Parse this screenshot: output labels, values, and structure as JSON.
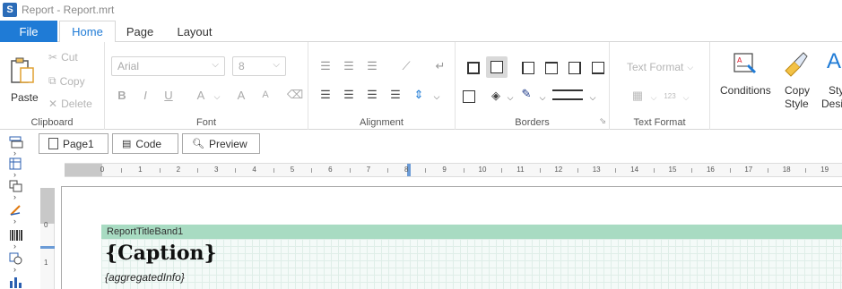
{
  "window": {
    "title": "Report - Report.mrt"
  },
  "ribbon_tabs": {
    "file": "File",
    "home": "Home",
    "page": "Page",
    "layout": "Layout"
  },
  "clipboard": {
    "paste": "Paste",
    "cut": "Cut",
    "copy": "Copy",
    "delete": "Delete",
    "label": "Clipboard"
  },
  "font": {
    "family": "Arial",
    "size": "8",
    "label": "Font",
    "bold": "B",
    "italic": "I",
    "underline": "U",
    "grow": "A",
    "shrink": "A"
  },
  "alignment": {
    "label": "Alignment"
  },
  "borders": {
    "label": "Borders"
  },
  "text_format": {
    "value": "Text Format",
    "label": "Text Format",
    "num_badge": "123"
  },
  "styles": {
    "conditions": "Conditions",
    "copy_style_line1": "Copy",
    "copy_style_line2": "Style",
    "style_designer_line1": "Sty",
    "style_designer_line2": "Desi"
  },
  "doc_tabs": {
    "page": "Page1",
    "code": "Code",
    "preview": "Preview"
  },
  "ruler": {
    "labels": [
      "0",
      "1",
      "2",
      "3",
      "4",
      "5",
      "6",
      "7",
      "8",
      "9",
      "10",
      "11",
      "12",
      "13",
      "14",
      "15",
      "16",
      "17",
      "18",
      "19"
    ],
    "vlabels": [
      "0",
      "1"
    ]
  },
  "band": {
    "name": "ReportTitleBand1"
  },
  "content": {
    "caption": "{Caption}",
    "aggregated": "{aggregatedInfo}"
  },
  "colors": {
    "accent": "#1f7bd6",
    "band": "#a8dbc2",
    "ruler_marker": "#6b9bd6"
  }
}
